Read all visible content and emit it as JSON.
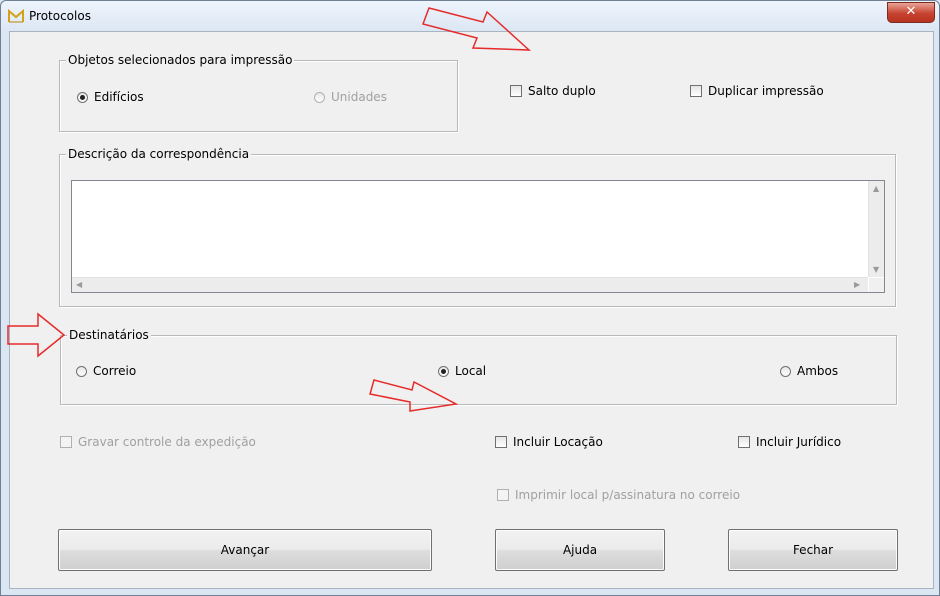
{
  "window": {
    "title": "Protocolos",
    "close_glyph": "✕"
  },
  "objetos_group": {
    "label": "Objetos selecionados para impressão",
    "edificios": {
      "label": "Edifícios",
      "checked": true
    },
    "unidades": {
      "label": "Unidades",
      "checked": false,
      "enabled": false
    }
  },
  "options": {
    "salto_duplo": {
      "label": "Salto duplo",
      "checked": false
    },
    "duplicar_impressao": {
      "label": "Duplicar impressão",
      "checked": false
    }
  },
  "descricao_group": {
    "label": "Descrição da correspondência",
    "value": ""
  },
  "destinatarios_group": {
    "label": "Destinatários",
    "correio": {
      "label": "Correio",
      "checked": false
    },
    "local": {
      "label": "Local",
      "checked": true
    },
    "ambos": {
      "label": "Ambos",
      "checked": false
    }
  },
  "extras": {
    "gravar_controle": {
      "label": "Gravar controle da expedição",
      "checked": false,
      "enabled": false
    },
    "incluir_locacao": {
      "label": "Incluir Locação",
      "checked": false
    },
    "incluir_juridico": {
      "label": "Incluir Jurídico",
      "checked": false
    },
    "imprimir_local": {
      "label": "Imprimir local p/assinatura no correio",
      "checked": false,
      "enabled": false
    }
  },
  "buttons": {
    "avancar": "Avançar",
    "ajuda": "Ajuda",
    "fechar": "Fechar"
  },
  "colors": {
    "annotation_arrow": "#e52b2b",
    "close_button": "#c7422f"
  },
  "icons": {
    "app": "app-logo-icon",
    "close": "close-icon"
  }
}
